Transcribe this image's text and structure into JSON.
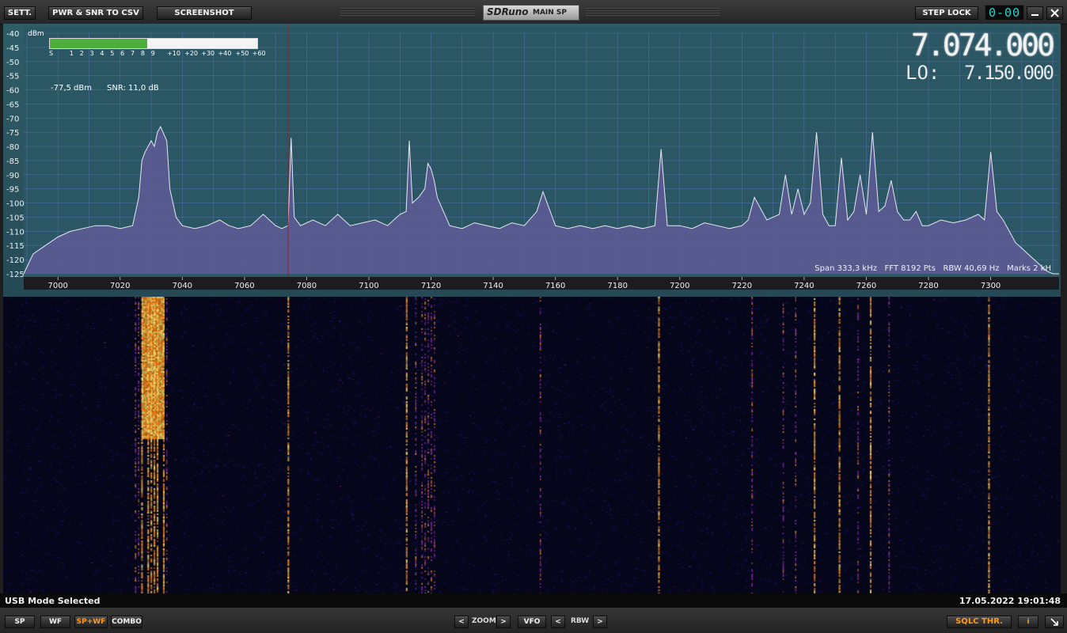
{
  "toolbar": {
    "settings_label": "SETT.",
    "csv_label": "PWR & SNR TO CSV",
    "screenshot_label": "SCREENSHOT",
    "brand": "SDRuno",
    "panel_name": "MAIN SP",
    "step_lock_label": "STEP LOCK",
    "clock_display": "0-00",
    "minimize_icon": "minimize-icon",
    "close_icon": "close-icon"
  },
  "spectrum": {
    "frequency": "7.074.000",
    "lo_label": "LO:",
    "lo_frequency": "7.150.000",
    "unit": "dBm",
    "level": "-77,5 dBm",
    "snr": "SNR: 11,0 dB",
    "meter_labels": [
      "S",
      "1",
      "2",
      "3",
      "4",
      "5",
      "6",
      "7",
      "8",
      "9",
      "+10",
      "+20",
      "+30",
      "+40",
      "+50",
      "+60"
    ],
    "meter_level_fraction": 0.47,
    "info": "Span 333,3 kHz   FFT 8192 Pts   RBW 40,69 Hz   Marks 2 kH",
    "colors": {
      "background": "#2c5560",
      "fill": "#5e5a95",
      "trace": "#e8e8f2",
      "grid": "#4d6ea0",
      "cursor": "#b01818",
      "meter": "#4caf3a"
    }
  },
  "chart_data": {
    "type": "area",
    "xlabel": "",
    "ylabel": "dBm",
    "xlim": [
      6989,
      7322
    ],
    "ylim": [
      -125,
      -40
    ],
    "x_ticks": [
      7000,
      7020,
      7040,
      7060,
      7080,
      7100,
      7120,
      7140,
      7160,
      7180,
      7200,
      7220,
      7240,
      7260,
      7280,
      7300
    ],
    "y_ticks": [
      -40,
      -45,
      -50,
      -55,
      -60,
      -65,
      -70,
      -75,
      -80,
      -85,
      -90,
      -95,
      -100,
      -105,
      -110,
      -115,
      -120,
      -125
    ],
    "cursor_khz": 7074,
    "series": [
      {
        "x": [
          6989,
          6992,
          6996,
          7000,
          7004,
          7008,
          7012,
          7016,
          7020,
          7024,
          7026,
          7027,
          7028,
          7030,
          7031,
          7032,
          7033,
          7035,
          7036,
          7038,
          7040,
          7044,
          7048,
          7052,
          7055,
          7058,
          7062,
          7066,
          7070,
          7072,
          7074,
          7075,
          7076,
          7078,
          7082,
          7086,
          7090,
          7094,
          7098,
          7102,
          7106,
          7110,
          7112,
          7113,
          7114,
          7116,
          7118,
          7119,
          7120,
          7121,
          7122,
          7124,
          7126,
          7130,
          7134,
          7138,
          7142,
          7146,
          7150,
          7154,
          7156,
          7160,
          7164,
          7168,
          7172,
          7176,
          7180,
          7184,
          7188,
          7192,
          7194,
          7196,
          7200,
          7204,
          7208,
          7212,
          7216,
          7220,
          7222,
          7224,
          7228,
          7232,
          7234,
          7236,
          7238,
          7240,
          7242,
          7244,
          7246,
          7248,
          7250,
          7252,
          7254,
          7256,
          7258,
          7260,
          7262,
          7264,
          7266,
          7268,
          7270,
          7272,
          7274,
          7276,
          7278,
          7280,
          7284,
          7288,
          7292,
          7296,
          7298,
          7300,
          7302,
          7304,
          7306,
          7308,
          7310,
          7312,
          7314,
          7316,
          7318,
          7320,
          7322
        ],
        "y": [
          -125,
          -118,
          -115,
          -112,
          -110,
          -109,
          -108,
          -108,
          -109,
          -108,
          -98,
          -85,
          -82,
          -78,
          -80,
          -75,
          -73,
          -78,
          -95,
          -105,
          -108,
          -109,
          -108,
          -106,
          -108,
          -109,
          -108,
          -104,
          -108,
          -109,
          -108,
          -77,
          -105,
          -108,
          -106,
          -108,
          -104,
          -108,
          -107,
          -106,
          -108,
          -104,
          -103,
          -78,
          -100,
          -98,
          -95,
          -86,
          -88,
          -92,
          -98,
          -103,
          -108,
          -109,
          -107,
          -108,
          -109,
          -107,
          -108,
          -103,
          -96,
          -108,
          -109,
          -108,
          -109,
          -108,
          -109,
          -108,
          -109,
          -108,
          -81,
          -108,
          -108,
          -109,
          -107,
          -108,
          -109,
          -108,
          -106,
          -98,
          -106,
          -104,
          -90,
          -104,
          -95,
          -104,
          -100,
          -75,
          -104,
          -108,
          -108,
          -84,
          -106,
          -103,
          -90,
          -104,
          -75,
          -103,
          -101,
          -92,
          -103,
          -106,
          -106,
          -103,
          -108,
          -108,
          -106,
          -107,
          -106,
          -104,
          -106,
          -82,
          -103,
          -106,
          -110,
          -114,
          -116,
          -118,
          -120,
          -122,
          -124,
          -125,
          -125
        ],
        "name": ""
      }
    ]
  },
  "waterfall": {
    "colors": {
      "background": "#05061a",
      "low": "#2a1b8a",
      "mid": "#9b2cb8",
      "high": "#ff8a1a",
      "peak": "#ffe06a"
    }
  },
  "status": {
    "mode": "USB Mode Selected",
    "datetime": "17.05.2022 19:01:48"
  },
  "bottom": {
    "sp_label": "SP",
    "wf_label": "WF",
    "spwf_label": "SP+WF",
    "combo_label": "COMBO",
    "zoom_label": "ZOOM",
    "vfo_label": "VFO",
    "rbw_label": "RBW",
    "left_arrow": "<",
    "right_arrow": ">",
    "sqlc_label": "SQLC THR.",
    "info_label": "i",
    "resize_icon": "resize-icon"
  }
}
